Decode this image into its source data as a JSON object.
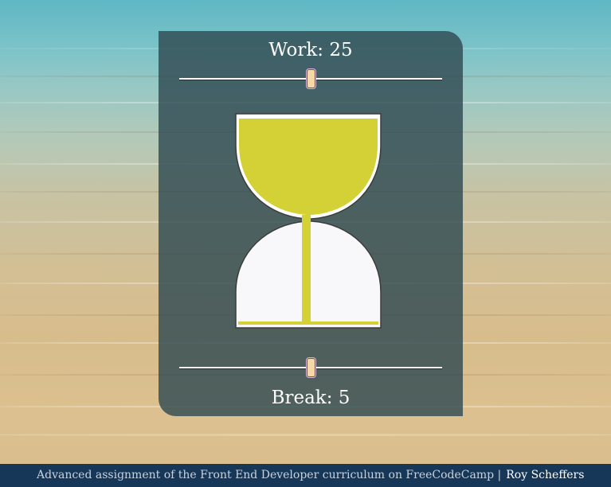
{
  "timer": {
    "work_label": "Work: 25",
    "break_label": "Break: 5",
    "work_value": 25,
    "break_value": 5,
    "work_slider_level": 0.5,
    "break_slider_level": 0.5
  },
  "hourglass": {
    "top_fill_color": "#d4d137",
    "bottom_color": "#f8f8fb",
    "stream_color": "#d4d137"
  },
  "footer": {
    "text": "Advanced assignment of the Front End Developer curriculum on FreeCodeCamp |",
    "author": "Roy Scheffers"
  },
  "colors": {
    "card_background": "#2f4b52",
    "footer_background": "#173759"
  }
}
